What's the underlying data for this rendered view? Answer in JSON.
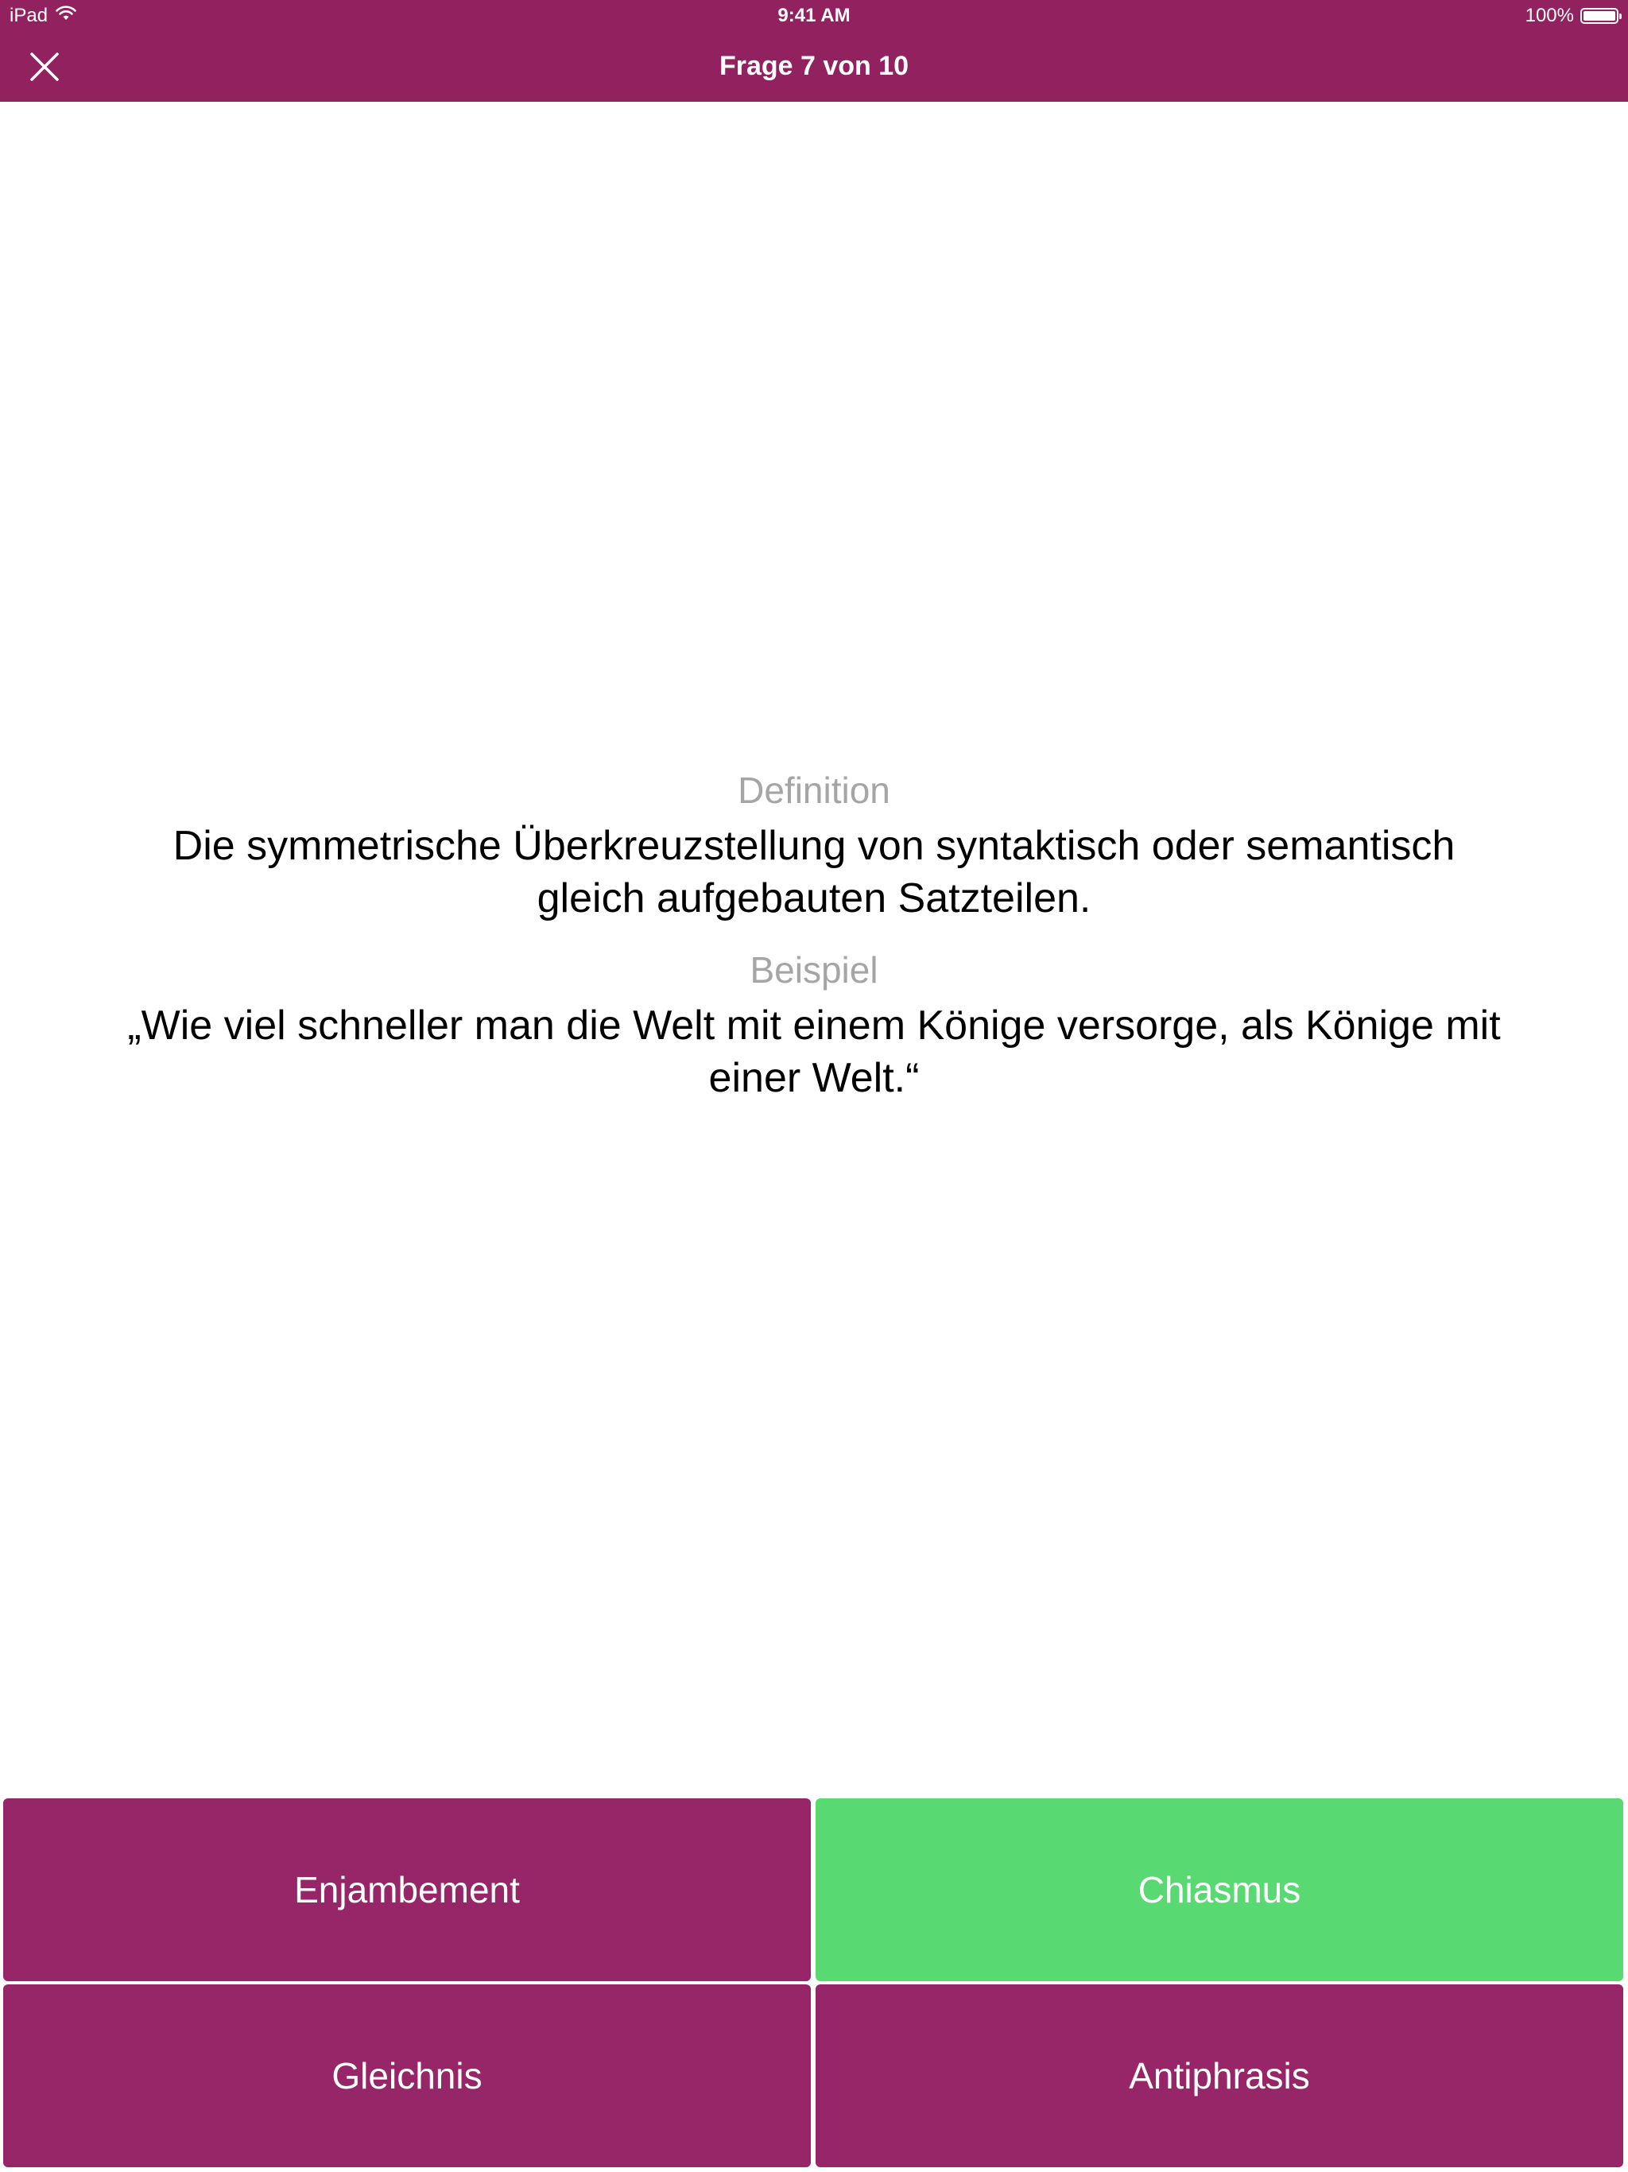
{
  "status_bar": {
    "device": "iPad",
    "time": "9:41 AM",
    "battery_text": "100%",
    "battery_level": 1.0
  },
  "nav": {
    "title": "Frage 7 von 10"
  },
  "question": {
    "definition_label": "Definition",
    "definition_text": "Die symmetrische Überkreuzstellung von syntaktisch oder semantisch gleich aufgebauten Satzteilen.",
    "example_label": "Beispiel",
    "example_text": "„Wie viel schneller man die Welt mit einem Könige versorge, als Könige mit einer Welt.“"
  },
  "answers": [
    {
      "label": "Enjambement",
      "color": "#962667",
      "state": "default"
    },
    {
      "label": "Chiasmus",
      "color": "#59d971",
      "state": "correct"
    },
    {
      "label": "Gleichnis",
      "color": "#962667",
      "state": "default"
    },
    {
      "label": "Antiphrasis",
      "color": "#962667",
      "state": "default"
    }
  ],
  "colors": {
    "brand": "#922160",
    "answer_default": "#962667",
    "answer_correct": "#59d971",
    "label_gray": "#a5a5a5"
  },
  "icons": {
    "close": "close-icon",
    "wifi": "wifi-icon",
    "battery": "battery-icon"
  }
}
